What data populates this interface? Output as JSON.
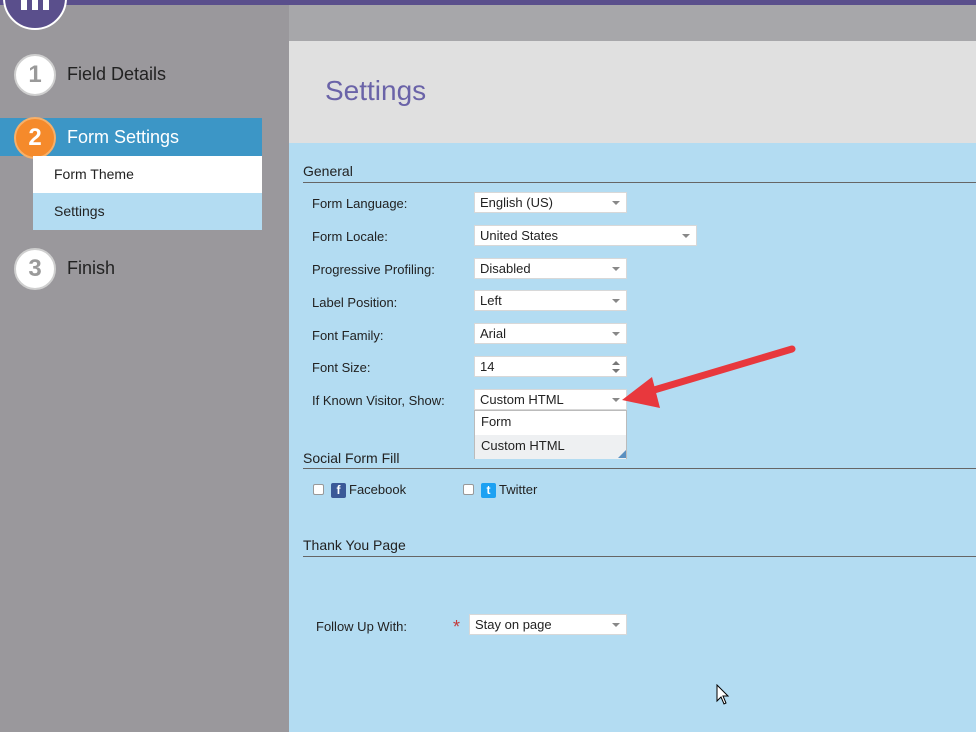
{
  "colors": {
    "brand": "#5a4f8c",
    "active_step": "#3c96c6",
    "step_badge": "#f58a2b",
    "content_bg": "#b3dcf2",
    "arrow": "#e8383d"
  },
  "sidebar": {
    "steps": [
      {
        "number": "1",
        "label": "Field Details"
      },
      {
        "number": "2",
        "label": "Form Settings"
      },
      {
        "number": "3",
        "label": "Finish"
      }
    ],
    "sub_items": [
      {
        "label": "Form Theme"
      },
      {
        "label": "Settings"
      }
    ]
  },
  "page": {
    "title": "Settings"
  },
  "general": {
    "heading": "General",
    "fields": [
      {
        "label": "Form Language:",
        "value": "English (US)"
      },
      {
        "label": "Form Locale:",
        "value": "United States"
      },
      {
        "label": "Progressive Profiling:",
        "value": "Disabled"
      },
      {
        "label": "Label Position:",
        "value": "Left"
      },
      {
        "label": "Font Family:",
        "value": "Arial"
      },
      {
        "label": "Font Size:",
        "value": "14"
      },
      {
        "label": "If Known Visitor, Show:",
        "value": "Custom HTML"
      }
    ],
    "dropdown_options": [
      "Form",
      "Custom HTML"
    ]
  },
  "social": {
    "heading": "Social Form Fill",
    "facebook": "Facebook",
    "twitter": "Twitter",
    "facebook_icon": "facebook-icon",
    "twitter_icon": "twitter-icon"
  },
  "thankyou": {
    "heading": "Thank You Page",
    "follow_label": "Follow Up With:",
    "required_mark": "*",
    "follow_value": "Stay on page"
  }
}
